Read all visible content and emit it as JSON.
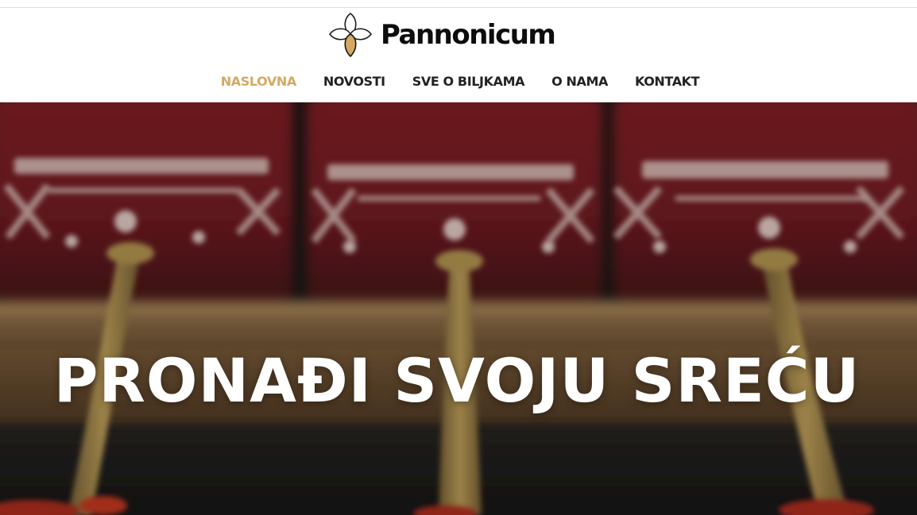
{
  "brand": {
    "name": "Pannonicum",
    "logo_icon": "quatrefoil-leaf-icon",
    "accent_color": "#d4a961"
  },
  "nav": {
    "items": [
      {
        "label": "NASLOVNA",
        "active": true
      },
      {
        "label": "NOVOSTI",
        "active": false
      },
      {
        "label": "SVE O BILJKAMA",
        "active": false
      },
      {
        "label": "O NAMA",
        "active": false
      },
      {
        "label": "KONTAKT",
        "active": false
      }
    ]
  },
  "hero": {
    "title": "PRONAĐI SVOJU SREĆU",
    "jar_labels": [
      "TRADICIONALNE PAPRIČICE",
      "TRADICIONALNA PAPRIKA",
      "TRADICIONALNA PAPRIKA"
    ]
  }
}
